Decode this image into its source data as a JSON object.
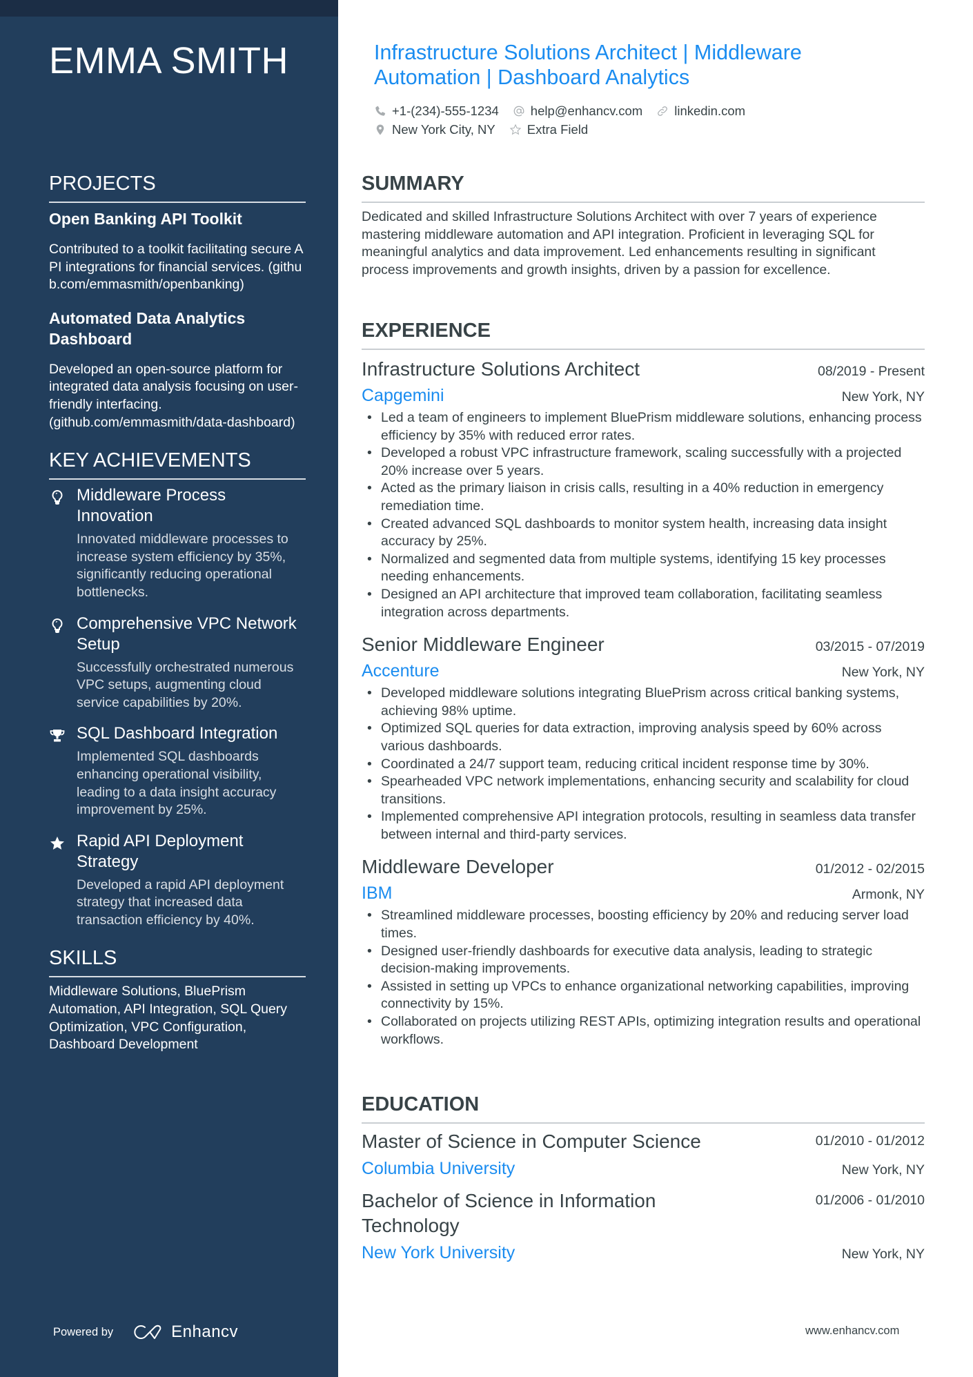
{
  "colors": {
    "sidebar_bg": "#223e5c",
    "sidebar_topband": "#1b2d45",
    "accent": "#1a8cf0",
    "text": "#384347"
  },
  "profile": {
    "name": "EMMA SMITH",
    "headline": "Infrastructure Solutions Architect | Middleware Automation | Dashboard Analytics",
    "contacts": {
      "phone": {
        "icon": "phone-icon",
        "value": "+1-(234)-555-1234"
      },
      "email": {
        "icon": "at-icon",
        "value": "help@enhancv.com"
      },
      "linkedin": {
        "icon": "link-icon",
        "value": "linkedin.com"
      },
      "location": {
        "icon": "location-pin-icon",
        "value": "New York City, NY"
      },
      "extra": {
        "icon": "star-outline-icon",
        "value": "Extra Field"
      }
    }
  },
  "sidebar": {
    "projects": {
      "heading": "PROJECTS",
      "items": [
        {
          "title": "Open Banking API Toolkit",
          "description": "Contributed to a toolkit facilitating secure API integrations for financial services. (github.com/emmasmith/openbanking)"
        },
        {
          "title": "Automated Data Analytics Dashboard",
          "description": "Developed an open-source platform for integrated data analysis focusing on user-friendly interfacing. (github.com/emmasmith/data-dashboard)"
        }
      ]
    },
    "achievements": {
      "heading": "KEY ACHIEVEMENTS",
      "items": [
        {
          "icon": "lightbulb-icon",
          "title": "Middleware Process Innovation",
          "description": "Innovated middleware processes to increase system efficiency by 35%, significantly reducing operational bottlenecks."
        },
        {
          "icon": "lightbulb-icon",
          "title": "Comprehensive VPC Network Setup",
          "description": "Successfully orchestrated numerous VPC setups, augmenting cloud service capabilities by 20%."
        },
        {
          "icon": "trophy-icon",
          "title": "SQL Dashboard Integration",
          "description": "Implemented SQL dashboards enhancing operational visibility, leading to a data insight accuracy improvement by 25%."
        },
        {
          "icon": "star-icon",
          "title": "Rapid API Deployment Strategy",
          "description": "Developed a rapid API deployment strategy that increased data transaction efficiency by 40%."
        }
      ]
    },
    "skills": {
      "heading": "SKILLS",
      "text": "Middleware Solutions, BluePrism Automation, API Integration, SQL Query Optimization, VPC Configuration, Dashboard Development"
    },
    "powered_by": {
      "label": "Powered by",
      "brand": "Enhancv"
    }
  },
  "main": {
    "summary": {
      "heading": "SUMMARY",
      "text": "Dedicated and skilled Infrastructure Solutions Architect with over 7 years of experience mastering middleware automation and API integration. Proficient in leveraging SQL for meaningful analytics and data improvement. Led enhancements resulting in significant process improvements and growth insights, driven by a passion for excellence."
    },
    "experience": {
      "heading": "EXPERIENCE",
      "jobs": [
        {
          "title": "Infrastructure Solutions Architect",
          "dates": "08/2019 - Present",
          "company": "Capgemini",
          "location": "New York, NY",
          "bullets": [
            "Led a team of engineers to implement BluePrism middleware solutions, enhancing process efficiency by 35% with reduced error rates.",
            "Developed a robust VPC infrastructure framework, scaling successfully with a projected 20% increase over 5 years.",
            "Acted as the primary liaison in crisis calls, resulting in a 40% reduction in emergency remediation time.",
            "Created advanced SQL dashboards to monitor system health, increasing data insight accuracy by 25%.",
            "Normalized and segmented data from multiple systems, identifying 15 key processes needing enhancements.",
            "Designed an API architecture that improved team collaboration, facilitating seamless integration across departments."
          ]
        },
        {
          "title": "Senior Middleware Engineer",
          "dates": "03/2015 - 07/2019",
          "company": "Accenture",
          "location": "New York, NY",
          "bullets": [
            "Developed middleware solutions integrating BluePrism across critical banking systems, achieving 98% uptime.",
            "Optimized SQL queries for data extraction, improving analysis speed by 60% across various dashboards.",
            "Coordinated a 24/7 support team, reducing critical incident response time by 30%.",
            "Spearheaded VPC network implementations, enhancing security and scalability for cloud transitions.",
            "Implemented comprehensive API integration protocols, resulting in seamless data transfer between internal and third-party services."
          ]
        },
        {
          "title": "Middleware Developer",
          "dates": "01/2012 - 02/2015",
          "company": "IBM",
          "location": "Armonk, NY",
          "bullets": [
            "Streamlined middleware processes, boosting efficiency by 20% and reducing server load times.",
            "Designed user-friendly dashboards for executive data analysis, leading to strategic decision-making improvements.",
            "Assisted in setting up VPCs to enhance organizational networking capabilities, improving connectivity by 15%.",
            "Collaborated on projects utilizing REST APIs, optimizing integration results and operational workflows."
          ]
        }
      ]
    },
    "education": {
      "heading": "EDUCATION",
      "items": [
        {
          "degree": "Master of Science in Computer Science",
          "dates": "01/2010 - 01/2012",
          "school": "Columbia University",
          "location": "New York, NY"
        },
        {
          "degree": "Bachelor of Science in Information Technology",
          "dates": "01/2006 - 01/2010",
          "school": "New York University",
          "location": "New York, NY"
        }
      ]
    }
  },
  "footer": {
    "url": "www.enhancv.com"
  }
}
